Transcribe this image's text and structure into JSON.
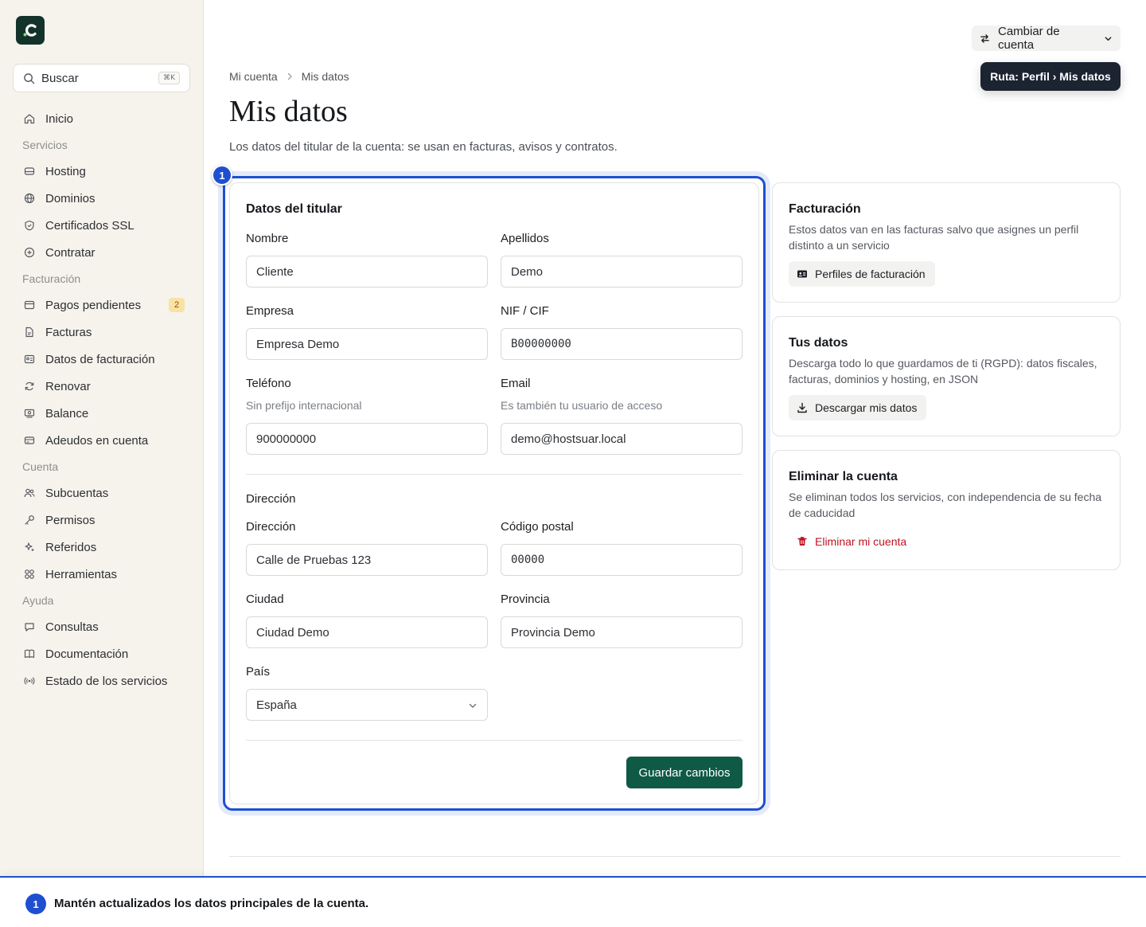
{
  "colors": {
    "brand": "#13332a",
    "primary": "#0f5a45",
    "highlight": "#1f4fd1",
    "danger": "#c01420",
    "sidebar_bg": "#f6f3ec"
  },
  "sidebar": {
    "logo_icon": "brand-logo-icon",
    "search": {
      "label": "Buscar",
      "shortcut": "⌘K"
    },
    "inicio": "Inicio",
    "sections": {
      "servicios": "Servicios",
      "facturacion": "Facturación",
      "cuenta": "Cuenta",
      "ayuda": "Ayuda"
    },
    "items": {
      "hosting": "Hosting",
      "dominios": "Dominios",
      "ssl": "Certificados SSL",
      "contratar": "Contratar",
      "pagos": "Pagos pendientes",
      "pagos_badge": "2",
      "facturas": "Facturas",
      "datos_facturacion": "Datos de facturación",
      "renovar": "Renovar",
      "balance": "Balance",
      "adeudos": "Adeudos en cuenta",
      "subcuentas": "Subcuentas",
      "permisos": "Permisos",
      "referidos": "Referidos",
      "herramientas": "Herramientas",
      "consultas": "Consultas",
      "documentacion": "Documentación",
      "estado": "Estado de los servicios"
    }
  },
  "topbar": {
    "account_switch": "Cambiar de cuenta",
    "route_tip": "Ruta: Perfil › Mis datos"
  },
  "header": {
    "breadcrumb": [
      "Mi cuenta",
      "Mis datos"
    ],
    "title": "Mis datos",
    "subtitle": "Los datos del titular de la cuenta: se usan en facturas, avisos y contratos."
  },
  "form": {
    "step": "1",
    "heading": "Datos del titular",
    "fields": {
      "nombre": {
        "label": "Nombre",
        "value": "Cliente"
      },
      "apellidos": {
        "label": "Apellidos",
        "value": "Demo"
      },
      "empresa": {
        "label": "Empresa",
        "value": "Empresa Demo"
      },
      "nif": {
        "label": "NIF / CIF",
        "value": "B00000000"
      },
      "telefono": {
        "label": "Teléfono",
        "hint": "Sin prefijo internacional",
        "value": "900000000"
      },
      "email": {
        "label": "Email",
        "hint": "Es también tu usuario de acceso",
        "value": "demo@hostsuar.local"
      },
      "direccion": {
        "label": "Dirección",
        "value": "Calle de Pruebas 123"
      },
      "cp": {
        "label": "Código postal",
        "value": "00000"
      },
      "ciudad": {
        "label": "Ciudad",
        "value": "Ciudad Demo"
      },
      "provincia": {
        "label": "Provincia",
        "value": "Provincia Demo"
      },
      "pais": {
        "label": "País",
        "value": "España"
      }
    },
    "address_heading": "Dirección",
    "save": "Guardar cambios"
  },
  "side": {
    "facturacion": {
      "title": "Facturación",
      "desc": "Estos datos van en las facturas salvo que asignes un perfil distinto a un servicio",
      "button": "Perfiles de facturación"
    },
    "tus_datos": {
      "title": "Tus datos",
      "desc": "Descarga todo lo que guardamos de ti (RGPD): datos fiscales, facturas, dominios y hosting, en JSON",
      "button": "Descargar mis datos"
    },
    "eliminar": {
      "title": "Eliminar la cuenta",
      "desc": "Se eliminan todos los servicios, con independencia de su fecha de caducidad",
      "button": "Eliminar mi cuenta"
    }
  },
  "footer": {
    "step": "1",
    "text": "Mantén actualizados los datos principales de la cuenta."
  }
}
